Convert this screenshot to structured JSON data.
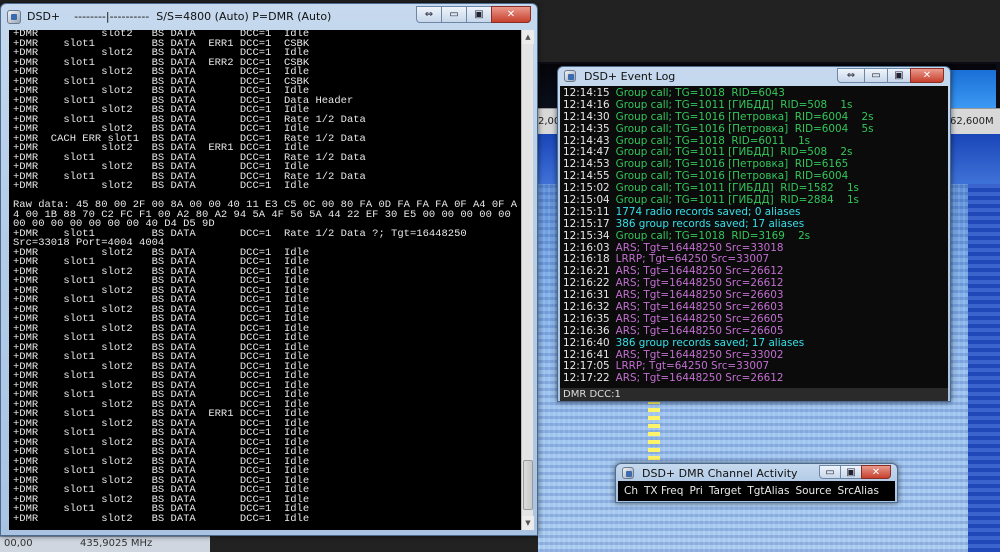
{
  "background_app": {
    "freq_left": "2,00",
    "freq_right": "62,600M",
    "status_left": "435,9025 MHz",
    "status_prefix": "00,00"
  },
  "console": {
    "title": "DSD+    --------|----------  S/S=4800 (Auto) P=DMR (Auto)",
    "lines": [
      "+DMR          slot2   BS DATA       DCC=1  Idle",
      "+DMR    slot1         BS DATA  ERR1 DCC=1  CSBK",
      "+DMR          slot2   BS DATA       DCC=1  Idle",
      "+DMR    slot1         BS DATA  ERR2 DCC=1  CSBK",
      "+DMR          slot2   BS DATA       DCC=1  Idle",
      "+DMR    slot1         BS DATA       DCC=1  CSBK",
      "+DMR          slot2   BS DATA       DCC=1  Idle",
      "+DMR    slot1         BS DATA       DCC=1  Data Header",
      "+DMR          slot2   BS DATA       DCC=1  Idle",
      "+DMR    slot1         BS DATA       DCC=1  Rate 1/2 Data",
      "+DMR          slot2   BS DATA       DCC=1  Idle",
      "+DMR  CACH ERR slot1  BS DATA       DCC=1  Rate 1/2 Data",
      "+DMR          slot2   BS DATA  ERR1 DCC=1  Idle",
      "+DMR    slot1         BS DATA       DCC=1  Rate 1/2 Data",
      "+DMR          slot2   BS DATA       DCC=1  Idle",
      "+DMR    slot1         BS DATA       DCC=1  Rate 1/2 Data",
      "+DMR          slot2   BS DATA       DCC=1  Idle",
      "",
      "Raw data: 45 80 00 2F 00 8A 00 00 40 11 E3 C5 0C 00 80 FA 0D FA FA FA 0F A4 0F A",
      "4 00 1B 88 70 C2 FC F1 00 A2 80 A2 94 5A 4F 56 5A 44 22 EF 30 E5 00 00 00 00 00",
      "00 00 00 00 00 00 00 40 D4 D5 9D",
      "+DMR    slot1         BS DATA       DCC=1  Rate 1/2 Data ?; Tgt=16448250",
      "Src=33018 Port=4004 4004",
      "+DMR          slot2   BS DATA       DCC=1  Idle",
      "+DMR    slot1         BS DATA       DCC=1  Idle",
      "+DMR          slot2   BS DATA       DCC=1  Idle",
      "+DMR    slot1         BS DATA       DCC=1  Idle",
      "+DMR          slot2   BS DATA       DCC=1  Idle",
      "+DMR    slot1         BS DATA       DCC=1  Idle",
      "+DMR          slot2   BS DATA       DCC=1  Idle",
      "+DMR    slot1         BS DATA       DCC=1  Idle",
      "+DMR          slot2   BS DATA       DCC=1  Idle",
      "+DMR    slot1         BS DATA       DCC=1  Idle",
      "+DMR          slot2   BS DATA       DCC=1  Idle",
      "+DMR    slot1         BS DATA       DCC=1  Idle",
      "+DMR          slot2   BS DATA       DCC=1  Idle",
      "+DMR    slot1         BS DATA       DCC=1  Idle",
      "+DMR          slot2   BS DATA       DCC=1  Idle",
      "+DMR    slot1         BS DATA       DCC=1  Idle",
      "+DMR          slot2   BS DATA       DCC=1  Idle",
      "+DMR    slot1         BS DATA  ERR1 DCC=1  Idle",
      "+DMR          slot2   BS DATA       DCC=1  Idle",
      "+DMR    slot1         BS DATA       DCC=1  Idle",
      "+DMR          slot2   BS DATA       DCC=1  Idle",
      "+DMR    slot1         BS DATA       DCC=1  Idle",
      "+DMR          slot2   BS DATA       DCC=1  Idle",
      "+DMR    slot1         BS DATA       DCC=1  Idle",
      "+DMR          slot2   BS DATA       DCC=1  Idle",
      "+DMR    slot1         BS DATA       DCC=1  Idle",
      "+DMR          slot2   BS DATA       DCC=1  Idle",
      "+DMR    slot1         BS DATA       DCC=1  Idle",
      "+DMR          slot2   BS DATA       DCC=1  Idle"
    ]
  },
  "event_log": {
    "title": "DSD+ Event Log",
    "status": "DMR  DCC:1",
    "colors": {
      "green": "#33c75a",
      "cyan": "#35e0e8",
      "purple": "#c36fd2"
    },
    "lines": [
      {
        "time": "12:14:15",
        "text": "Group call; TG=1018  RID=6043",
        "color": "green"
      },
      {
        "time": "12:14:16",
        "text": "Group call; TG=1011 [ГИБДД]  RID=508    1s",
        "color": "green"
      },
      {
        "time": "12:14:30",
        "text": "Group call; TG=1016 [Петровка]  RID=6004    2s",
        "color": "green"
      },
      {
        "time": "12:14:35",
        "text": "Group call; TG=1016 [Петровка]  RID=6004    5s",
        "color": "green"
      },
      {
        "time": "12:14:43",
        "text": "Group call; TG=1018  RID=6011    1s",
        "color": "green"
      },
      {
        "time": "12:14:47",
        "text": "Group call; TG=1011 [ГИБДД]  RID=508    2s",
        "color": "green"
      },
      {
        "time": "12:14:53",
        "text": "Group call; TG=1016 [Петровка]  RID=6165",
        "color": "green"
      },
      {
        "time": "12:14:55",
        "text": "Group call; TG=1016 [Петровка]  RID=6004",
        "color": "green"
      },
      {
        "time": "12:15:02",
        "text": "Group call; TG=1011 [ГИБДД]  RID=1582    1s",
        "color": "green"
      },
      {
        "time": "12:15:04",
        "text": "Group call; TG=1011 [ГИБДД]  RID=2884    1s",
        "color": "green"
      },
      {
        "time": "12:15:11",
        "text": "1774 radio records saved; 0 aliases",
        "color": "cyan"
      },
      {
        "time": "12:15:17",
        "text": "386 group records saved; 17 aliases",
        "color": "cyan"
      },
      {
        "time": "12:15:34",
        "text": "Group call; TG=1018  RID=3169    2s",
        "color": "green"
      },
      {
        "time": "12:16:03",
        "text": "ARS; Tgt=16448250 Src=33018",
        "color": "purple"
      },
      {
        "time": "12:16:18",
        "text": "LRRP; Tgt=64250 Src=33007",
        "color": "purple"
      },
      {
        "time": "12:16:21",
        "text": "ARS; Tgt=16448250 Src=26612",
        "color": "purple"
      },
      {
        "time": "12:16:22",
        "text": "ARS; Tgt=16448250 Src=26612",
        "color": "purple"
      },
      {
        "time": "12:16:31",
        "text": "ARS; Tgt=16448250 Src=26603",
        "color": "purple"
      },
      {
        "time": "12:16:32",
        "text": "ARS; Tgt=16448250 Src=26603",
        "color": "purple"
      },
      {
        "time": "12:16:35",
        "text": "ARS; Tgt=16448250 Src=26605",
        "color": "purple"
      },
      {
        "time": "12:16:36",
        "text": "ARS; Tgt=16448250 Src=26605",
        "color": "purple"
      },
      {
        "time": "12:16:40",
        "text": "386 group records saved; 17 aliases",
        "color": "cyan"
      },
      {
        "time": "12:16:41",
        "text": "ARS; Tgt=16448250 Src=33002",
        "color": "purple"
      },
      {
        "time": "12:17:05",
        "text": "LRRP; Tgt=64250 Src=33007",
        "color": "purple"
      },
      {
        "time": "12:17:22",
        "text": "ARS; Tgt=16448250 Src=26612",
        "color": "purple"
      }
    ]
  },
  "channel_activity": {
    "title": "DSD+ DMR Channel Activity",
    "columns": [
      "Ch",
      "TX Freq",
      "Pri",
      "Target",
      "TgtAlias",
      "Source",
      "SrcAlias"
    ]
  },
  "window_controls": {
    "restore": "⇔",
    "minimize": "▭",
    "maximize": "▣",
    "close": "✕"
  }
}
